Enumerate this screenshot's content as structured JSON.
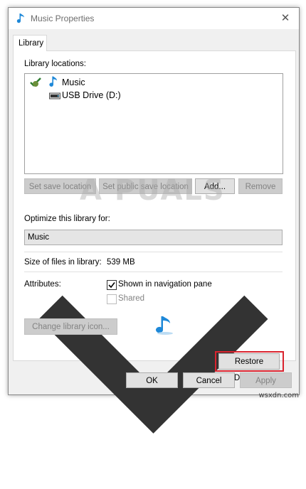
{
  "window": {
    "title": "Music Properties",
    "close_glyph": "✕"
  },
  "tabs": [
    {
      "label": "Library"
    }
  ],
  "locations": {
    "heading": "Library locations:",
    "items": [
      {
        "name": "Music",
        "icon": "music-note-icon",
        "default": true
      },
      {
        "name": "USB Drive (D:)",
        "icon": "drive-icon",
        "default": false
      }
    ]
  },
  "location_buttons": {
    "set_save": "Set save location",
    "set_public_save": "Set public save location",
    "add": "Add...",
    "remove": "Remove"
  },
  "optimize": {
    "label": "Optimize this library for:",
    "selected": "Music"
  },
  "size": {
    "label": "Size of files in library:",
    "value": "539 MB"
  },
  "attributes": {
    "label": "Attributes:",
    "shown_in_nav": {
      "label": "Shown in navigation pane",
      "checked": true
    },
    "shared": {
      "label": "Shared",
      "checked": false,
      "disabled": true
    }
  },
  "change_icon_button": "Change library icon...",
  "restore_defaults_button": "Restore Defaults",
  "footer": {
    "ok": "OK",
    "cancel": "Cancel",
    "apply": "Apply"
  },
  "watermark": "A  PUALS",
  "site_credit": "wsxdn.com",
  "colors": {
    "accent_blue": "#1e88d8",
    "highlight_red": "#d9232e"
  }
}
